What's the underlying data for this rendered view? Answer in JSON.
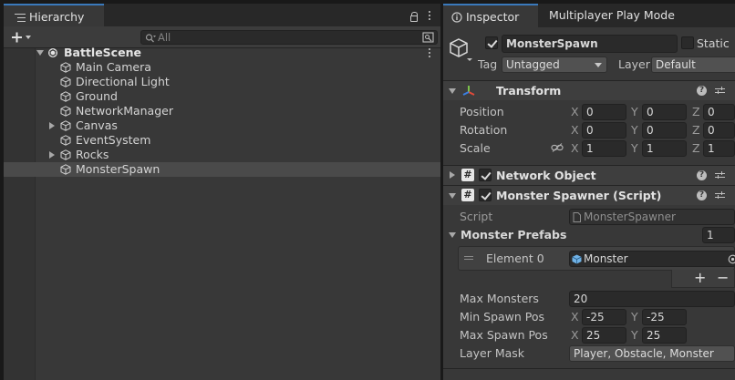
{
  "hierarchy": {
    "tab_label": "Hierarchy",
    "search_placeholder": "All",
    "scene_name": "BattleScene",
    "items": [
      {
        "label": "Main Camera"
      },
      {
        "label": "Directional Light"
      },
      {
        "label": "Ground"
      },
      {
        "label": "NetworkManager"
      },
      {
        "label": "Canvas"
      },
      {
        "label": "EventSystem"
      },
      {
        "label": "Rocks"
      },
      {
        "label": "MonsterSpawn"
      }
    ]
  },
  "inspector": {
    "tabs": [
      "Inspector",
      "Multiplayer Play Mode"
    ],
    "object_name": "MonsterSpawn",
    "static_label": "Static",
    "tag_label": "Tag",
    "tag_value": "Untagged",
    "layer_label": "Layer",
    "layer_value": "Default",
    "transform": {
      "title": "Transform",
      "position_label": "Position",
      "rotation_label": "Rotation",
      "scale_label": "Scale",
      "axis_x": "X",
      "axis_y": "Y",
      "axis_z": "Z",
      "position": [
        "0",
        "0",
        "0"
      ],
      "rotation": [
        "0",
        "0",
        "0"
      ],
      "scale": [
        "1",
        "1",
        "1"
      ]
    },
    "network_object": {
      "title": "Network Object"
    },
    "monster_spawner": {
      "title": "Monster Spawner (Script)",
      "script_label": "Script",
      "script_value": "MonsterSpawner",
      "prefabs_label": "Monster Prefabs",
      "prefabs_count": "1",
      "element_label": "Element 0",
      "element_value": "Monster",
      "add_label": "+",
      "remove_label": "−",
      "max_monsters_label": "Max Monsters",
      "max_monsters_value": "20",
      "min_spawn_label": "Min Spawn Pos",
      "min_spawn_x": "-25",
      "min_spawn_y": "-25",
      "max_spawn_label": "Max Spawn Pos",
      "max_spawn_x": "25",
      "max_spawn_y": "25",
      "layer_mask_label": "Layer Mask",
      "layer_mask_value": "Player, Obstacle, Monster"
    }
  },
  "colors": {
    "accent": "#3a79bb",
    "panel": "#383838",
    "selection": "#4a4a4a"
  }
}
